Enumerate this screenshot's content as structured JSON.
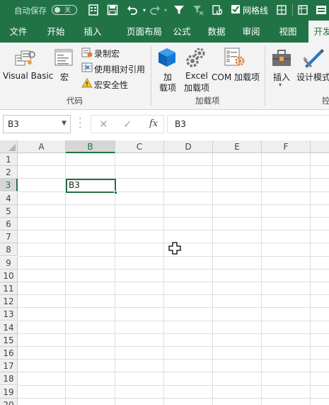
{
  "quick_access": {
    "autosave_label": "自动保存",
    "autosave_state": "关",
    "gridlines_label": "网格线",
    "gridlines_checked": true
  },
  "tabs": [
    {
      "label": "文件"
    },
    {
      "label": "开始"
    },
    {
      "label": "插入"
    },
    {
      "label": "页面布局"
    },
    {
      "label": "公式"
    },
    {
      "label": "数据"
    },
    {
      "label": "审阅"
    },
    {
      "label": "视图"
    },
    {
      "label": "开发",
      "active": true
    }
  ],
  "ribbon": {
    "code_group": {
      "label": "代码",
      "visual_basic": "Visual Basic",
      "macros": "宏",
      "record_macro": "录制宏",
      "use_relative": "使用相对引用",
      "macro_security": "宏安全性"
    },
    "addins_group": {
      "label": "加载项",
      "addins_line1": "加",
      "addins_line2": "载项",
      "excel_addins_line1": "Excel",
      "excel_addins_line2": "加载项",
      "com_addins": "COM 加载项"
    },
    "controls_group": {
      "label": "控",
      "insert": "插入",
      "design_mode": "设计模式"
    }
  },
  "formula_bar": {
    "name_box": "B3",
    "content": "B3",
    "fx_label": "fx"
  },
  "sheet": {
    "columns": [
      "A",
      "B",
      "C",
      "D",
      "E",
      "F"
    ],
    "rows": [
      "1",
      "2",
      "3",
      "4",
      "5",
      "6",
      "7",
      "8",
      "9",
      "10",
      "11",
      "12",
      "13",
      "14",
      "15",
      "16",
      "17",
      "18",
      "19",
      "20"
    ],
    "selected_column": "B",
    "selected_row": "3",
    "active_cell_value": "B3"
  },
  "colors": {
    "accent": "#217346",
    "ribbon_bg": "#f3f3f3"
  }
}
